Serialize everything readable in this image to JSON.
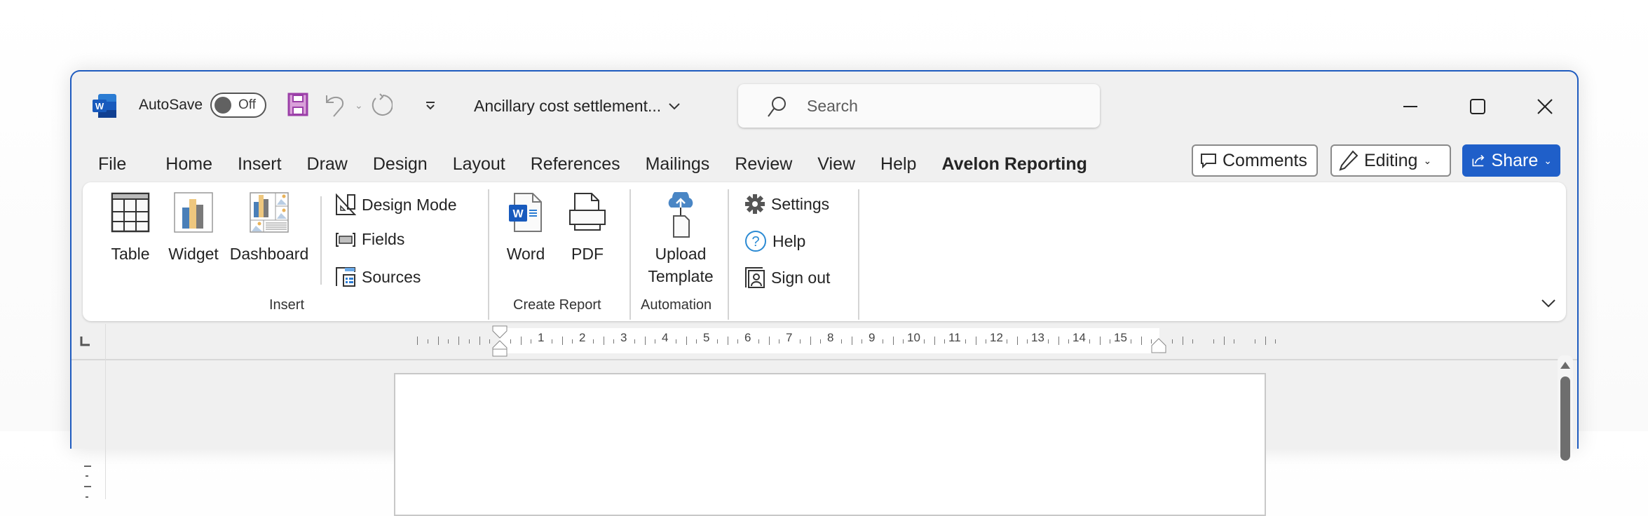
{
  "titlebar": {
    "autosave_label": "AutoSave",
    "autosave_state": "Off",
    "document_title": "Ancillary cost settlement...",
    "search_placeholder": "Search",
    "icons": [
      "word-logo-icon",
      "save-icon",
      "undo-icon",
      "redo-icon",
      "customize-qat-icon",
      "minimize-icon",
      "maximize-icon",
      "close-icon"
    ]
  },
  "tabs": [
    "File",
    "Home",
    "Insert",
    "Draw",
    "Design",
    "Layout",
    "References",
    "Mailings",
    "Review",
    "View",
    "Help",
    "Avelon Reporting"
  ],
  "active_tab": "Avelon Reporting",
  "header_buttons": {
    "comments": "Comments",
    "editing": "Editing",
    "share": "Share"
  },
  "colors": {
    "accent": "#1f5fc9",
    "tab_underline": "#1f4fa8",
    "save_icon": "#9b3fa8"
  },
  "ribbon": {
    "groups": [
      {
        "label": "Insert",
        "large": [
          "Table",
          "Widget",
          "Dashboard"
        ],
        "small": [
          "Design Mode",
          "Fields",
          "Sources"
        ]
      },
      {
        "label": "Create Report",
        "large": [
          "Word",
          "PDF"
        ]
      },
      {
        "label": "Automation",
        "large": [
          "Upload Template"
        ]
      },
      {
        "label": "",
        "small": [
          "Settings",
          "Help",
          "Sign out"
        ]
      }
    ],
    "upload_line1": "Upload",
    "upload_line2": "Template"
  },
  "ruler": {
    "labels": [
      "1",
      "2",
      "3",
      "4",
      "5",
      "6",
      "7",
      "8",
      "9",
      "10",
      "11",
      "12",
      "13",
      "14",
      "15"
    ]
  }
}
